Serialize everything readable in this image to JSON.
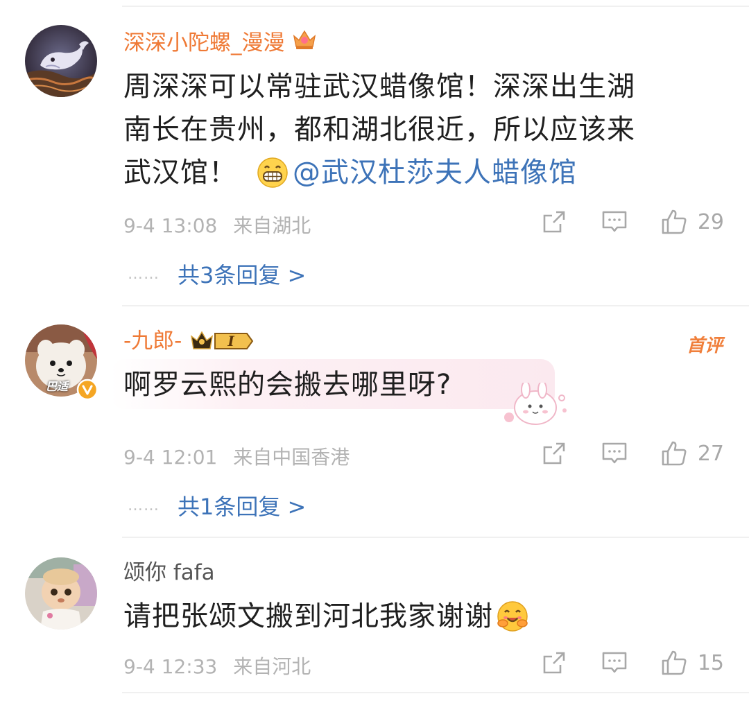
{
  "comments": [
    {
      "username": "深深小陀螺_漫漫",
      "text_line1": "周深深可以常驻武汉蜡像馆！深深出生湖",
      "text_line2": "南长在贵州，都和湖北很近，所以应该来",
      "text_line3_prefix": "武汉馆！",
      "emoji": "grin-emoji",
      "mention": "@武汉杜莎夫人蜡像馆",
      "time": "9-4 13:08",
      "location": "来自湖北",
      "likes": "29",
      "replies": "共3条回复 >",
      "reply_dots": "……"
    },
    {
      "username": "-九郎-",
      "level_badge": "I",
      "avatar_label": "巴适",
      "first_badge": "首评",
      "text": "啊罗云熙的会搬去哪里呀?",
      "time": "9-4 12:01",
      "location": "来自中国香港",
      "likes": "27",
      "replies": "共1条回复 >",
      "reply_dots": "……"
    },
    {
      "username": "颂你 fafa",
      "text": "请把张颂文搬到河北我家谢谢",
      "emoji": "hug-emoji",
      "time": "9-4 12:33",
      "location": "来自河北",
      "likes": "15"
    }
  ],
  "colors": {
    "accent_orange": "#ef7a36",
    "link_blue": "#3d73b8",
    "meta_gray": "#b3b3b3"
  }
}
